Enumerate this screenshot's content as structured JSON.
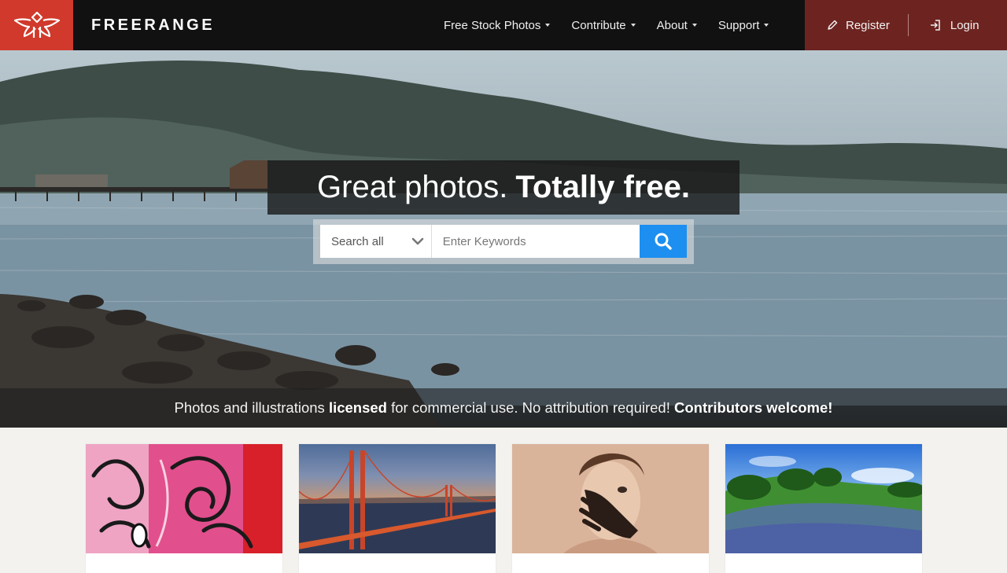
{
  "brand": {
    "name": "FREERANGE",
    "logo_icon": "winged-logo-icon",
    "accent_color": "#d0392b"
  },
  "nav": {
    "items": [
      {
        "label": "Free Stock Photos",
        "icon": "caret-down-icon"
      },
      {
        "label": "Contribute",
        "icon": "caret-down-icon"
      },
      {
        "label": "About",
        "icon": "caret-down-icon"
      },
      {
        "label": "Support",
        "icon": "caret-down-icon"
      }
    ],
    "register_label": "Register",
    "register_icon": "pencil-icon",
    "login_label": "Login",
    "login_icon": "login-icon"
  },
  "hero": {
    "headline_regular": "Great photos.",
    "headline_bold": "Totally free.",
    "search": {
      "category_selected": "Search all",
      "keyword_value": "",
      "keyword_placeholder": "Enter Keywords",
      "button_icon": "search-icon",
      "button_color": "#1d8ff0"
    },
    "tagline": {
      "part1": "Photos and illustrations ",
      "bold1": "licensed",
      "part2": " for commercial use. No attribution required! ",
      "bold2": "Contributors welcome!"
    }
  },
  "featured": [
    {
      "image": "graffiti-wall-photo"
    },
    {
      "image": "golden-gate-bridge-photo"
    },
    {
      "image": "painted-hand-face-photo"
    },
    {
      "image": "bluebonnet-field-photo"
    }
  ]
}
